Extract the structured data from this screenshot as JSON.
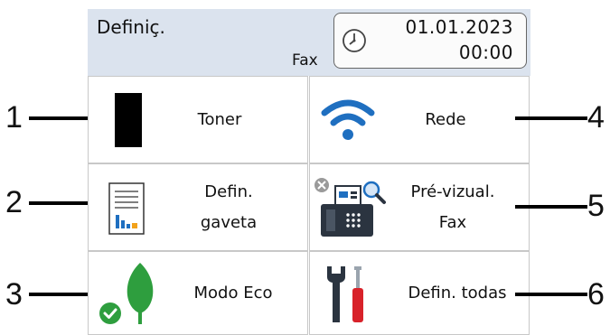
{
  "header": {
    "title": "Definiç.",
    "mode": "Fax",
    "date": "01.01.2023",
    "time": "00:00"
  },
  "tiles": {
    "toner": {
      "label": "Toner",
      "icon": "toner-icon"
    },
    "network": {
      "label": "Rede",
      "icon": "wifi-icon"
    },
    "tray": {
      "line1": "Defin.",
      "line2": "gaveta",
      "icon": "tray-settings-icon"
    },
    "fax_preview": {
      "line1": "Pré-vizual.",
      "line2": "Fax",
      "icon": "fax-preview-icon"
    },
    "eco": {
      "label": "Modo Eco",
      "icon": "eco-leaf-icon"
    },
    "all_settings": {
      "label": "Defin. todas",
      "icon": "tools-icon"
    }
  },
  "callouts": [
    "1",
    "2",
    "3",
    "4",
    "5",
    "6"
  ],
  "colors": {
    "header_bg": "#dbe3ee",
    "wifi_blue": "#1f6fc0",
    "eco_green": "#2e9e3e",
    "screwdriver_red": "#d8222a"
  }
}
